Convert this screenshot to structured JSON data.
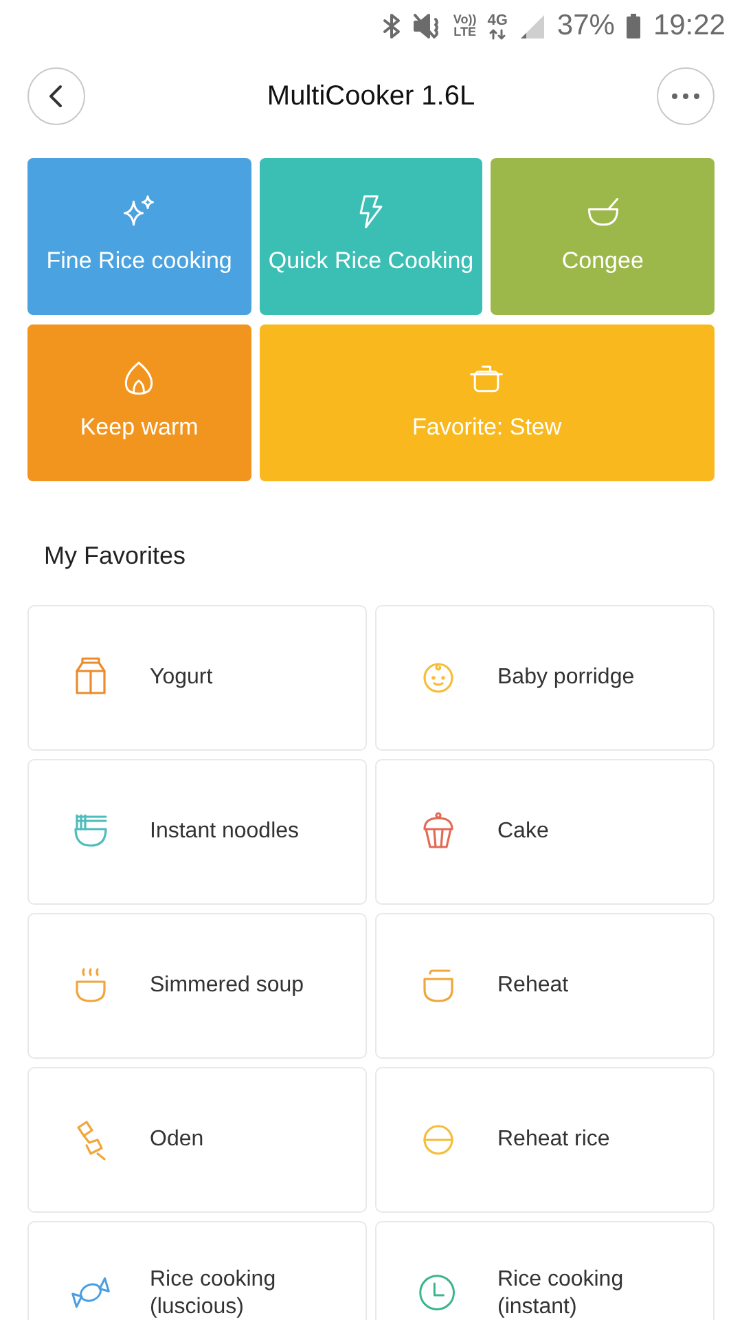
{
  "status_bar": {
    "volte": [
      "Vo))",
      "LTE"
    ],
    "network": "4G",
    "battery": "37%",
    "time": "19:22"
  },
  "header": {
    "title": "MultiCooker 1.6L"
  },
  "modes": [
    {
      "label": "Fine Rice cooking",
      "kind": "sparkle",
      "color": "#4aa3e0",
      "wide": false
    },
    {
      "label": "Quick Rice Cooking",
      "kind": "bolt",
      "color": "#3bbfb5",
      "wide": false
    },
    {
      "label": "Congee",
      "kind": "bowl",
      "color": "#9db84a",
      "wide": false
    },
    {
      "label": "Keep warm",
      "kind": "flame",
      "color": "#f2951f",
      "wide": false
    },
    {
      "label": "Favorite: Stew",
      "kind": "pot",
      "color": "#f9b81e",
      "wide": true
    }
  ],
  "favorites_title": "My Favorites",
  "favorites": [
    {
      "label": "Yogurt",
      "kind": "carton",
      "color": "#ec8c2c"
    },
    {
      "label": "Baby porridge",
      "kind": "baby",
      "color": "#f5bd3a"
    },
    {
      "label": "Instant noodles",
      "kind": "noodles",
      "color": "#4dbdbb"
    },
    {
      "label": "Cake",
      "kind": "cupcake",
      "color": "#e36a55"
    },
    {
      "label": "Simmered soup",
      "kind": "soup",
      "color": "#f0a63a"
    },
    {
      "label": "Reheat",
      "kind": "lidbowl",
      "color": "#f0a63a"
    },
    {
      "label": "Oden",
      "kind": "skewer",
      "color": "#f0a63a"
    },
    {
      "label": "Reheat rice",
      "kind": "rice",
      "color": "#f5bd3a"
    },
    {
      "label": "Rice cooking (luscious)",
      "kind": "candy",
      "color": "#4a9ee0"
    },
    {
      "label": "Rice cooking (instant)",
      "kind": "clock",
      "color": "#3bb68a"
    }
  ]
}
